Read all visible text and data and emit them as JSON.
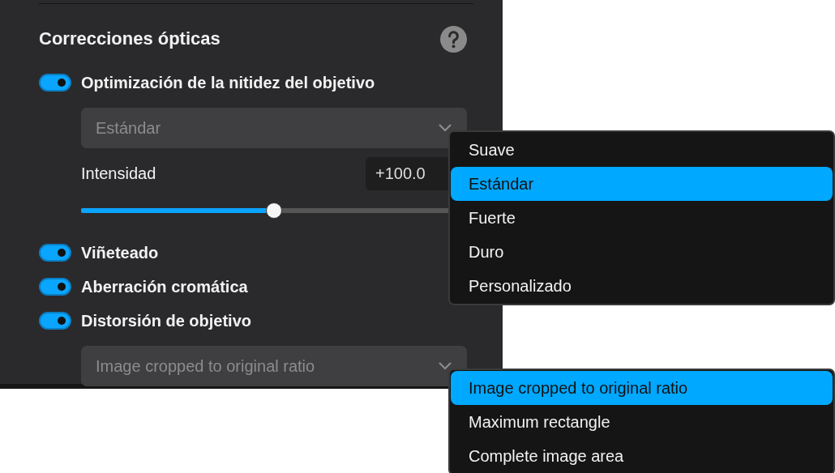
{
  "section": {
    "title": "Correcciones ópticas"
  },
  "settings": [
    {
      "kind": "toggle",
      "label": "Optimización de la nitidez del objetivo",
      "on": true
    },
    {
      "kind": "select",
      "value": "Estándar"
    },
    {
      "kind": "slider",
      "label": "Intensidad",
      "reading": "+100.0",
      "level": 0.5
    },
    {
      "kind": "toggle",
      "label": "Viñeteado",
      "on": true
    },
    {
      "kind": "toggle",
      "label": "Aberración cromática",
      "on": true
    },
    {
      "kind": "toggle",
      "label": "Distorsión de objetivo",
      "on": true
    },
    {
      "kind": "select",
      "value": "Image cropped to original ratio"
    }
  ],
  "menus": [
    {
      "items": [
        {
          "label": "Suave",
          "selected": false
        },
        {
          "label": "Estándar",
          "selected": true
        },
        {
          "label": "Fuerte",
          "selected": false
        },
        {
          "label": "Duro",
          "selected": false
        },
        {
          "label": "Personalizado",
          "selected": false
        }
      ]
    },
    {
      "items": [
        {
          "label": "Image cropped to original ratio",
          "selected": true
        },
        {
          "label": "Maximum rectangle",
          "selected": false
        },
        {
          "label": "Complete image area",
          "selected": false
        }
      ]
    }
  ]
}
